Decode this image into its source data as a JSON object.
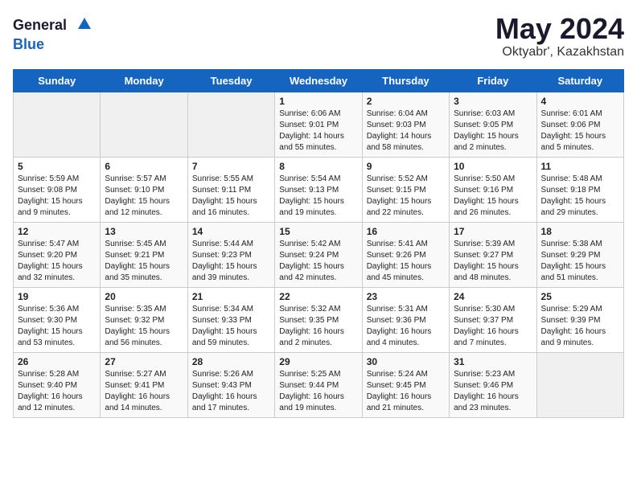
{
  "header": {
    "logo_general": "General",
    "logo_blue": "Blue",
    "title": "May 2024",
    "location": "Oktyabr', Kazakhstan"
  },
  "weekdays": [
    "Sunday",
    "Monday",
    "Tuesday",
    "Wednesday",
    "Thursday",
    "Friday",
    "Saturday"
  ],
  "weeks": [
    [
      {
        "day": "",
        "sunrise": "",
        "sunset": "",
        "daylight": "",
        "empty": true
      },
      {
        "day": "",
        "sunrise": "",
        "sunset": "",
        "daylight": "",
        "empty": true
      },
      {
        "day": "",
        "sunrise": "",
        "sunset": "",
        "daylight": "",
        "empty": true
      },
      {
        "day": "1",
        "sunrise": "Sunrise: 6:06 AM",
        "sunset": "Sunset: 9:01 PM",
        "daylight": "Daylight: 14 hours and 55 minutes."
      },
      {
        "day": "2",
        "sunrise": "Sunrise: 6:04 AM",
        "sunset": "Sunset: 9:03 PM",
        "daylight": "Daylight: 14 hours and 58 minutes."
      },
      {
        "day": "3",
        "sunrise": "Sunrise: 6:03 AM",
        "sunset": "Sunset: 9:05 PM",
        "daylight": "Daylight: 15 hours and 2 minutes."
      },
      {
        "day": "4",
        "sunrise": "Sunrise: 6:01 AM",
        "sunset": "Sunset: 9:06 PM",
        "daylight": "Daylight: 15 hours and 5 minutes."
      }
    ],
    [
      {
        "day": "5",
        "sunrise": "Sunrise: 5:59 AM",
        "sunset": "Sunset: 9:08 PM",
        "daylight": "Daylight: 15 hours and 9 minutes."
      },
      {
        "day": "6",
        "sunrise": "Sunrise: 5:57 AM",
        "sunset": "Sunset: 9:10 PM",
        "daylight": "Daylight: 15 hours and 12 minutes."
      },
      {
        "day": "7",
        "sunrise": "Sunrise: 5:55 AM",
        "sunset": "Sunset: 9:11 PM",
        "daylight": "Daylight: 15 hours and 16 minutes."
      },
      {
        "day": "8",
        "sunrise": "Sunrise: 5:54 AM",
        "sunset": "Sunset: 9:13 PM",
        "daylight": "Daylight: 15 hours and 19 minutes."
      },
      {
        "day": "9",
        "sunrise": "Sunrise: 5:52 AM",
        "sunset": "Sunset: 9:15 PM",
        "daylight": "Daylight: 15 hours and 22 minutes."
      },
      {
        "day": "10",
        "sunrise": "Sunrise: 5:50 AM",
        "sunset": "Sunset: 9:16 PM",
        "daylight": "Daylight: 15 hours and 26 minutes."
      },
      {
        "day": "11",
        "sunrise": "Sunrise: 5:48 AM",
        "sunset": "Sunset: 9:18 PM",
        "daylight": "Daylight: 15 hours and 29 minutes."
      }
    ],
    [
      {
        "day": "12",
        "sunrise": "Sunrise: 5:47 AM",
        "sunset": "Sunset: 9:20 PM",
        "daylight": "Daylight: 15 hours and 32 minutes."
      },
      {
        "day": "13",
        "sunrise": "Sunrise: 5:45 AM",
        "sunset": "Sunset: 9:21 PM",
        "daylight": "Daylight: 15 hours and 35 minutes."
      },
      {
        "day": "14",
        "sunrise": "Sunrise: 5:44 AM",
        "sunset": "Sunset: 9:23 PM",
        "daylight": "Daylight: 15 hours and 39 minutes."
      },
      {
        "day": "15",
        "sunrise": "Sunrise: 5:42 AM",
        "sunset": "Sunset: 9:24 PM",
        "daylight": "Daylight: 15 hours and 42 minutes."
      },
      {
        "day": "16",
        "sunrise": "Sunrise: 5:41 AM",
        "sunset": "Sunset: 9:26 PM",
        "daylight": "Daylight: 15 hours and 45 minutes."
      },
      {
        "day": "17",
        "sunrise": "Sunrise: 5:39 AM",
        "sunset": "Sunset: 9:27 PM",
        "daylight": "Daylight: 15 hours and 48 minutes."
      },
      {
        "day": "18",
        "sunrise": "Sunrise: 5:38 AM",
        "sunset": "Sunset: 9:29 PM",
        "daylight": "Daylight: 15 hours and 51 minutes."
      }
    ],
    [
      {
        "day": "19",
        "sunrise": "Sunrise: 5:36 AM",
        "sunset": "Sunset: 9:30 PM",
        "daylight": "Daylight: 15 hours and 53 minutes."
      },
      {
        "day": "20",
        "sunrise": "Sunrise: 5:35 AM",
        "sunset": "Sunset: 9:32 PM",
        "daylight": "Daylight: 15 hours and 56 minutes."
      },
      {
        "day": "21",
        "sunrise": "Sunrise: 5:34 AM",
        "sunset": "Sunset: 9:33 PM",
        "daylight": "Daylight: 15 hours and 59 minutes."
      },
      {
        "day": "22",
        "sunrise": "Sunrise: 5:32 AM",
        "sunset": "Sunset: 9:35 PM",
        "daylight": "Daylight: 16 hours and 2 minutes."
      },
      {
        "day": "23",
        "sunrise": "Sunrise: 5:31 AM",
        "sunset": "Sunset: 9:36 PM",
        "daylight": "Daylight: 16 hours and 4 minutes."
      },
      {
        "day": "24",
        "sunrise": "Sunrise: 5:30 AM",
        "sunset": "Sunset: 9:37 PM",
        "daylight": "Daylight: 16 hours and 7 minutes."
      },
      {
        "day": "25",
        "sunrise": "Sunrise: 5:29 AM",
        "sunset": "Sunset: 9:39 PM",
        "daylight": "Daylight: 16 hours and 9 minutes."
      }
    ],
    [
      {
        "day": "26",
        "sunrise": "Sunrise: 5:28 AM",
        "sunset": "Sunset: 9:40 PM",
        "daylight": "Daylight: 16 hours and 12 minutes."
      },
      {
        "day": "27",
        "sunrise": "Sunrise: 5:27 AM",
        "sunset": "Sunset: 9:41 PM",
        "daylight": "Daylight: 16 hours and 14 minutes."
      },
      {
        "day": "28",
        "sunrise": "Sunrise: 5:26 AM",
        "sunset": "Sunset: 9:43 PM",
        "daylight": "Daylight: 16 hours and 17 minutes."
      },
      {
        "day": "29",
        "sunrise": "Sunrise: 5:25 AM",
        "sunset": "Sunset: 9:44 PM",
        "daylight": "Daylight: 16 hours and 19 minutes."
      },
      {
        "day": "30",
        "sunrise": "Sunrise: 5:24 AM",
        "sunset": "Sunset: 9:45 PM",
        "daylight": "Daylight: 16 hours and 21 minutes."
      },
      {
        "day": "31",
        "sunrise": "Sunrise: 5:23 AM",
        "sunset": "Sunset: 9:46 PM",
        "daylight": "Daylight: 16 hours and 23 minutes."
      },
      {
        "day": "",
        "sunrise": "",
        "sunset": "",
        "daylight": "",
        "empty": true
      }
    ]
  ]
}
